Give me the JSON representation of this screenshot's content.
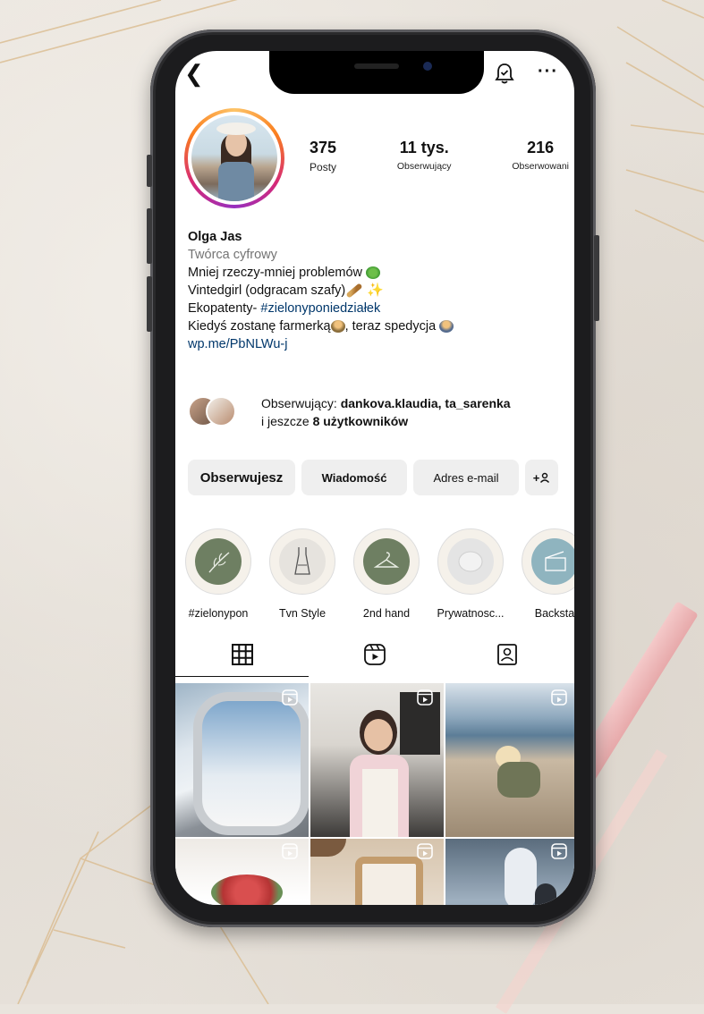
{
  "profile": {
    "posts_count": "375",
    "posts_label": "Posty",
    "followers_count": "11 tys.",
    "followers_label": "Obserwujący",
    "following_count": "216",
    "following_label": "Obserwowani",
    "name": "Olga Jas",
    "category": "Twórca cyfrowy",
    "bio_line1": "Mniej rzeczy-mniej problemów",
    "bio_line2": "Vintedgirl (odgracam szafy)",
    "bio_line3_prefix": "Ekopatenty-",
    "bio_line3_hashtag": "#zielonyponiedziałek",
    "bio_line4_a": "Kiedyś zostanę  farmerką",
    "bio_line4_b": ", teraz spedycja",
    "link": "wp.me/PbNLWu-j"
  },
  "followed_by": {
    "prefix": "Obserwujący:",
    "names": "dankova.klaudia, ta_sarenka",
    "suffix_prefix": "i jeszcze",
    "suffix_count": "8 użytkowników"
  },
  "actions": {
    "follow": "Obserwujesz",
    "message": "Wiadomość",
    "email": "Adres e-mail",
    "add_user": "+"
  },
  "highlights": [
    {
      "label": "#zielonypon",
      "color": "#6e7f62"
    },
    {
      "label": "Tvn Style",
      "color": "#e6e3de"
    },
    {
      "label": "2nd hand",
      "color": "#6e7f62"
    },
    {
      "label": "Prywatnosc...",
      "color": "#e4e4e4"
    },
    {
      "label": "Backsta",
      "color": "#8fb4bf"
    }
  ],
  "colors": {
    "link": "#00376b",
    "avatar_gradient": [
      "#fdc468",
      "#fa7e1e",
      "#d62976",
      "#962fbf"
    ]
  },
  "icons": [
    "back-icon",
    "notification-bell-icon",
    "more-icon",
    "grid-icon",
    "reels-icon",
    "tagged-icon",
    "reel-badge-icon"
  ]
}
